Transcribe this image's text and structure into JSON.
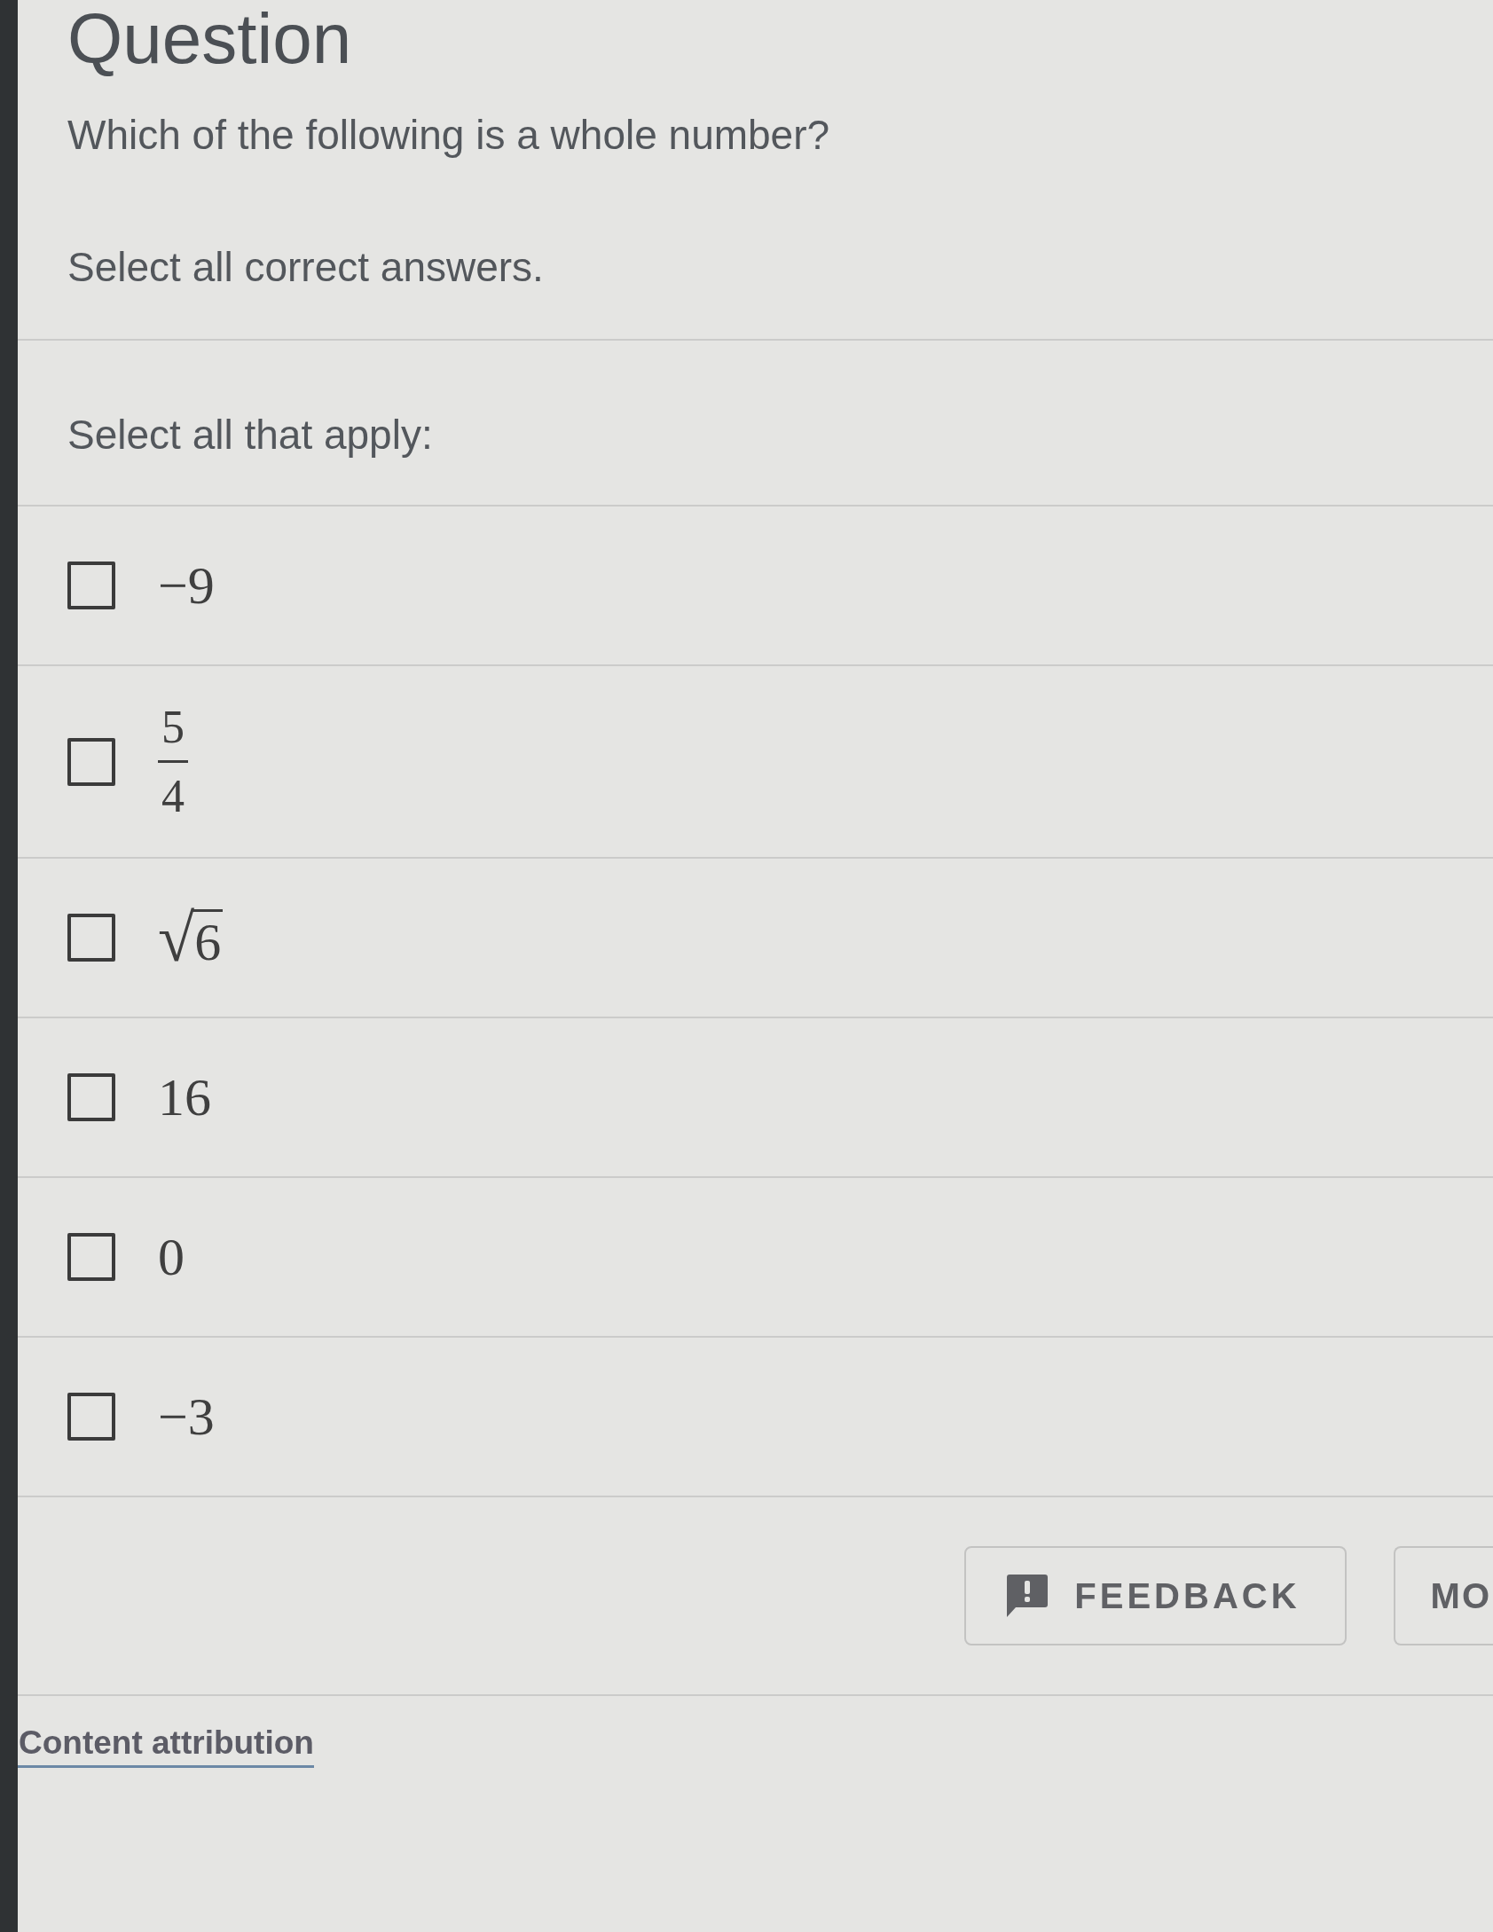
{
  "heading": "Question",
  "question": {
    "text": "Which of the following is a whole number?",
    "instruction": "Select all correct answers."
  },
  "answer_prompt": "Select all that apply:",
  "options": [
    {
      "kind": "number",
      "text": "−9",
      "checked": false
    },
    {
      "kind": "fraction",
      "numerator": "5",
      "denominator": "4",
      "checked": false
    },
    {
      "kind": "root",
      "radical": "√",
      "radicand": "6",
      "checked": false
    },
    {
      "kind": "number",
      "text": "16",
      "checked": false
    },
    {
      "kind": "number",
      "text": "0",
      "checked": false
    },
    {
      "kind": "number",
      "text": "−3",
      "checked": false
    }
  ],
  "buttons": [
    {
      "kind": "with_icon",
      "label": "FEEDBACK"
    },
    {
      "kind": "plain",
      "label": "MO"
    }
  ],
  "attribution_link": "Content attribution"
}
